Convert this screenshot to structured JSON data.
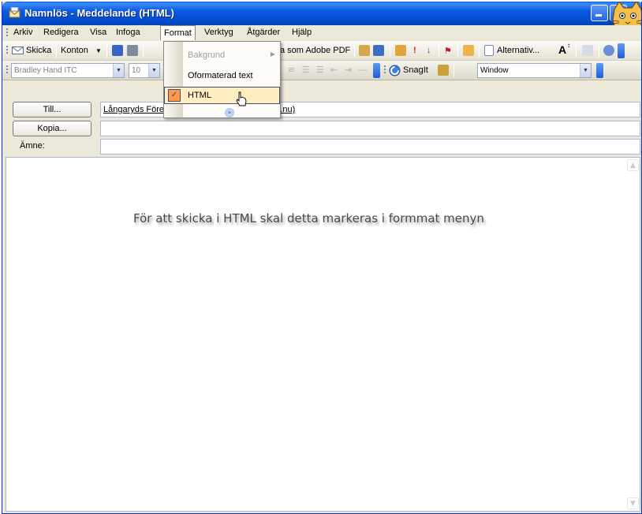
{
  "window": {
    "title": "Namnlös - Meddelande (HTML)"
  },
  "menubar": {
    "items": [
      "Arkiv",
      "Redigera",
      "Visa",
      "Infoga",
      "Format",
      "Verktyg",
      "Åtgärder",
      "Hjälp"
    ],
    "active": "Format"
  },
  "toolbar1": {
    "send_label": "Skicka",
    "accounts_label": "Konton",
    "save_as_pdf_label": "a som Adobe PDF",
    "options_label": "Alternativ...",
    "font_size_glyph": "A"
  },
  "toolbar2": {
    "font_name": "Bradley Hand ITC",
    "font_size": "10",
    "snagit_label": "SnagIt",
    "capture_mode": "Window"
  },
  "format_menu": {
    "items": [
      {
        "label": "Bakgrund",
        "disabled": true,
        "has_submenu": true
      },
      {
        "label": "Oformaterad text",
        "disabled": false
      },
      {
        "label": "HTML",
        "disabled": false,
        "checked": true,
        "highlighted": true
      }
    ]
  },
  "header": {
    "to_button": "Till...",
    "to_value_left": "Långaryds Före",
    "to_value_right": "ryd.nu)",
    "cc_button": "Kopia...",
    "cc_value": "",
    "subject_label": "Ämne:",
    "subject_value": ""
  },
  "body": {
    "text": "För att skicka i HTML skal detta markeras i formmat menyn"
  },
  "colors": {
    "titlebar": "#0350d6",
    "chrome": "#ece9d8",
    "menu_highlight": "#ffeec2",
    "check_bg": "#ff9a4c"
  }
}
